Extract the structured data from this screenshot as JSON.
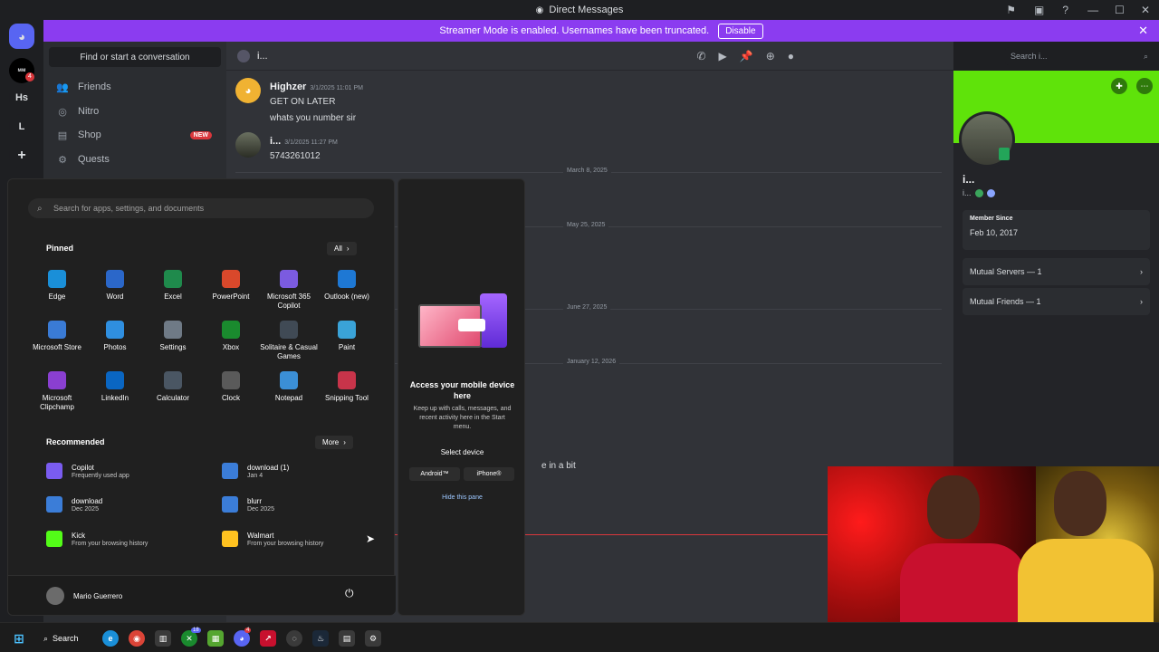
{
  "window": {
    "title": "Direct Messages"
  },
  "streamer_banner": {
    "text": "Streamer Mode is enabled. Usernames have been truncated.",
    "button": "Disable"
  },
  "rail": {
    "servers": [
      "Hs",
      "L"
    ],
    "mention_count": "4"
  },
  "sidebar": {
    "find": "Find or start a conversation",
    "items": [
      {
        "label": "Friends",
        "icon": "friends-icon"
      },
      {
        "label": "Nitro",
        "icon": "nitro-icon"
      },
      {
        "label": "Shop",
        "icon": "shop-icon",
        "badge": "NEW"
      },
      {
        "label": "Quests",
        "icon": "quests-icon"
      }
    ]
  },
  "chat": {
    "header_name": "i...",
    "search_placeholder": "Search i...",
    "messages": [
      {
        "author": "Highzer",
        "time": "3/1/2025 11:01 PM",
        "lines": [
          "GET ON LATER",
          "whats you number sir"
        ]
      },
      {
        "author": "i...",
        "time": "3/1/2025 11:27 PM",
        "lines": [
          "5743261012"
        ]
      }
    ],
    "dates": [
      "March 8, 2025",
      "May 25, 2025",
      "June 27, 2025",
      "January 12, 2026"
    ],
    "partial_text": "e in a bit"
  },
  "profile": {
    "name": "i...",
    "sub": "i...",
    "member_since_label": "Member Since",
    "member_since": "Feb 10, 2017",
    "mutual_servers": "Mutual Servers — 1",
    "mutual_friends": "Mutual Friends — 1",
    "banner_color": "#5fe30a"
  },
  "start_menu": {
    "search_placeholder": "Search for apps, settings, and documents",
    "pinned_label": "Pinned",
    "all_label": "All",
    "pinned": [
      {
        "name": "Edge",
        "icon": "edge-icon",
        "color": "#1a8fd8"
      },
      {
        "name": "Word",
        "icon": "word-icon",
        "color": "#2b67c9"
      },
      {
        "name": "Excel",
        "icon": "excel-icon",
        "color": "#1f8a4c"
      },
      {
        "name": "PowerPoint",
        "icon": "powerpoint-icon",
        "color": "#d9482b"
      },
      {
        "name": "Microsoft 365 Copilot",
        "icon": "m365-copilot-icon",
        "color": "#7b5be0"
      },
      {
        "name": "Outlook (new)",
        "icon": "outlook-icon",
        "color": "#1e78d4"
      },
      {
        "name": "Microsoft Store",
        "icon": "store-icon",
        "color": "#3a7bd5"
      },
      {
        "name": "Photos",
        "icon": "photos-icon",
        "color": "#2f8fe0"
      },
      {
        "name": "Settings",
        "icon": "settings-icon",
        "color": "#6f7a86"
      },
      {
        "name": "Xbox",
        "icon": "xbox-icon",
        "color": "#1a8a2e"
      },
      {
        "name": "Solitaire & Casual Games",
        "icon": "solitaire-icon",
        "color": "#404a55"
      },
      {
        "name": "Paint",
        "icon": "paint-icon",
        "color": "#3aa3d8"
      },
      {
        "name": "Microsoft Clipchamp",
        "icon": "clipchamp-icon",
        "color": "#8a3fd1"
      },
      {
        "name": "LinkedIn",
        "icon": "linkedin-icon",
        "color": "#0a66c2"
      },
      {
        "name": "Calculator",
        "icon": "calculator-icon",
        "color": "#4a5663"
      },
      {
        "name": "Clock",
        "icon": "clock-icon",
        "color": "#5a5a5a"
      },
      {
        "name": "Notepad",
        "icon": "notepad-icon",
        "color": "#3b8fd6"
      },
      {
        "name": "Snipping Tool",
        "icon": "snipping-icon",
        "color": "#c8344a"
      }
    ],
    "recommended_label": "Recommended",
    "more_label": "More",
    "recommended": [
      {
        "title": "Copilot",
        "sub": "Frequently used app",
        "icon": "copilot-icon",
        "color": "#7a5cf0"
      },
      {
        "title": "download (1)",
        "sub": "Jan 4",
        "icon": "document-icon",
        "color": "#3b7dd8"
      },
      {
        "title": "download",
        "sub": "Dec 2025",
        "icon": "document-icon",
        "color": "#3b7dd8"
      },
      {
        "title": "blurr",
        "sub": "Dec 2025",
        "icon": "document-icon",
        "color": "#3b7dd8"
      },
      {
        "title": "Kick",
        "sub": "From your browsing history",
        "icon": "kick-icon",
        "color": "#53fc18"
      },
      {
        "title": "Walmart",
        "sub": "From your browsing history",
        "icon": "walmart-icon",
        "color": "#ffc220"
      }
    ],
    "user": "Mario Guerrero"
  },
  "phone_pane": {
    "title": "Access your mobile device here",
    "body": "Keep up with calls, messages, and recent activity here in the Start menu.",
    "select": "Select device",
    "android": "Android™",
    "iphone": "iPhone®",
    "hide": "Hide this pane"
  },
  "taskbar": {
    "search": "Search",
    "xbox_badge": "18",
    "discord_badge": "4"
  }
}
